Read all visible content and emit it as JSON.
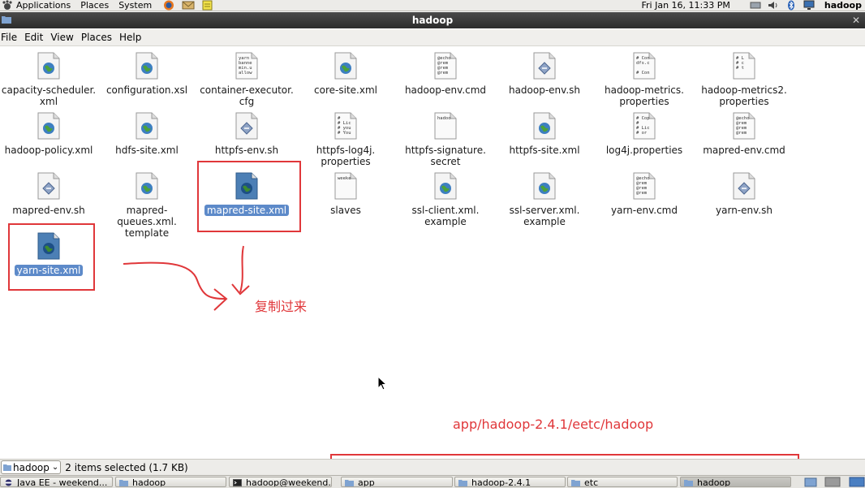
{
  "top_panel": {
    "menus": [
      "Applications",
      "Places",
      "System"
    ],
    "clock": "Fri Jan 16, 11:33 PM",
    "user": "hadoop"
  },
  "window": {
    "title": "hadoop",
    "menu": [
      "File",
      "Edit",
      "View",
      "Places",
      "Help"
    ]
  },
  "files": [
    {
      "name": "capacity-scheduler.\nxml",
      "icon": "web-doc-icon"
    },
    {
      "name": "configuration.xsl",
      "icon": "web-doc-icon"
    },
    {
      "name": "container-executor.\ncfg",
      "icon": "text-doc-icon",
      "preview": "yarn\nbanne\nmin.u\nallow"
    },
    {
      "name": "core-site.xml",
      "icon": "web-doc-icon"
    },
    {
      "name": "hadoop-env.cmd",
      "icon": "text-doc-icon",
      "preview": "@echo\n@rem\n@rem\n@rem"
    },
    {
      "name": "hadoop-env.sh",
      "icon": "script-doc-icon"
    },
    {
      "name": "hadoop-metrics.\nproperties",
      "icon": "text-doc-icon",
      "preview": "# Con\ndfs.c\n\n# Con"
    },
    {
      "name": "hadoop-metrics2.\nproperties",
      "icon": "text-doc-icon",
      "preview": "#  L\n#  c\n#  t"
    },
    {
      "name": "hadoop-policy.xml",
      "icon": "web-doc-icon"
    },
    {
      "name": "hdfs-site.xml",
      "icon": "web-doc-icon"
    },
    {
      "name": "httpfs-env.sh",
      "icon": "script-doc-icon"
    },
    {
      "name": "httpfs-log4j.\nproperties",
      "icon": "text-doc-icon",
      "preview": "#\n# Lic\n# you\n# You"
    },
    {
      "name": "httpfs-signature.\nsecret",
      "icon": "text-doc-icon",
      "preview": "hadoo"
    },
    {
      "name": "httpfs-site.xml",
      "icon": "web-doc-icon"
    },
    {
      "name": "log4j.properties",
      "icon": "text-doc-icon",
      "preview": "# Cop\n#\n# Lic\n# or"
    },
    {
      "name": "mapred-env.cmd",
      "icon": "text-doc-icon",
      "preview": "@echo\n@rem\n@rem\n@rem"
    },
    {
      "name": "mapred-env.sh",
      "icon": "script-doc-icon"
    },
    {
      "name": "mapred-queues.xml.\ntemplate",
      "icon": "web-doc-icon"
    },
    {
      "name": "mapred-site.xml",
      "icon": "web-doc-selected-icon",
      "selected": true
    },
    {
      "name": "slaves",
      "icon": "text-doc-icon",
      "preview": "weeke"
    },
    {
      "name": "ssl-client.xml.\nexample",
      "icon": "web-doc-icon"
    },
    {
      "name": "ssl-server.xml.\nexample",
      "icon": "web-doc-icon"
    },
    {
      "name": "yarn-env.cmd",
      "icon": "text-doc-icon",
      "preview": "@echo\n@rem\n@rem\n@rem"
    },
    {
      "name": "yarn-env.sh",
      "icon": "script-doc-icon"
    },
    {
      "name": "yarn-site.xml",
      "icon": "web-doc-selected-icon",
      "selected": true
    }
  ],
  "annotations": {
    "copy_note": "复制过来",
    "path_note": "app/hadoop-2.4.1/eetc/hadoop",
    "accent": "#e0373a"
  },
  "status": {
    "location": "hadoop",
    "selection": "2 items selected (1.7 KB)"
  },
  "taskbar": [
    {
      "label": "Java EE - weekend...",
      "icon": "eclipse-icon"
    },
    {
      "label": "hadoop",
      "icon": "folder-icon"
    },
    {
      "label": "hadoop@weekend...",
      "icon": "terminal-icon"
    },
    {
      "label": "app",
      "icon": "folder-icon"
    },
    {
      "label": "hadoop-2.4.1",
      "icon": "folder-icon"
    },
    {
      "label": "etc",
      "icon": "folder-icon"
    },
    {
      "label": "hadoop",
      "icon": "folder-icon",
      "active": true
    }
  ]
}
